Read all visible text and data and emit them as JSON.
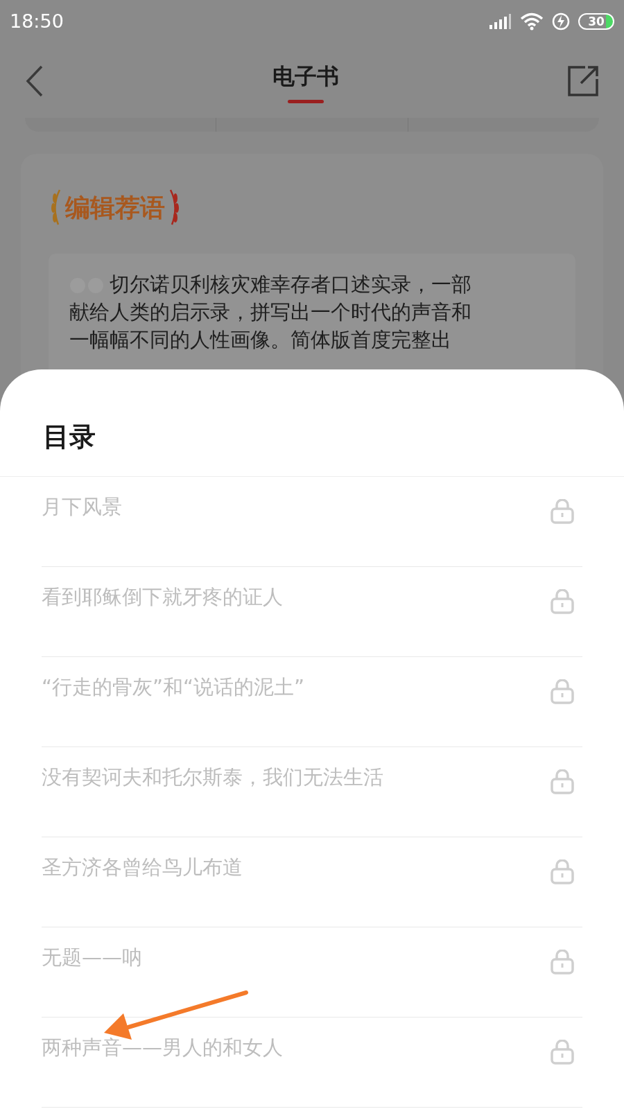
{
  "status_bar": {
    "time": "18:50",
    "battery": "30"
  },
  "header": {
    "title": "电子书"
  },
  "recommendation": {
    "heading": "编辑荐语",
    "lines": [
      "切尔诺贝利核灾难幸存者口述实录，一部",
      "献给人类的启示录，拼写出一个时代的声音和",
      "一幅幅不同的人性画像。简体版首度完整出"
    ]
  },
  "contents": {
    "title": "目录",
    "items": [
      {
        "label": "月下风景",
        "locked": true
      },
      {
        "label": "看到耶稣倒下就牙疼的证人",
        "locked": true
      },
      {
        "label": "“行走的骨灰”和“说话的泥土”",
        "locked": true
      },
      {
        "label": "没有契诃夫和托尔斯泰，我们无法生活",
        "locked": true
      },
      {
        "label": "圣方济各曾给鸟儿布道",
        "locked": true
      },
      {
        "label": "无题——呐",
        "locked": true
      },
      {
        "label": "两种声音——男人的和女人",
        "locked": true
      }
    ]
  }
}
